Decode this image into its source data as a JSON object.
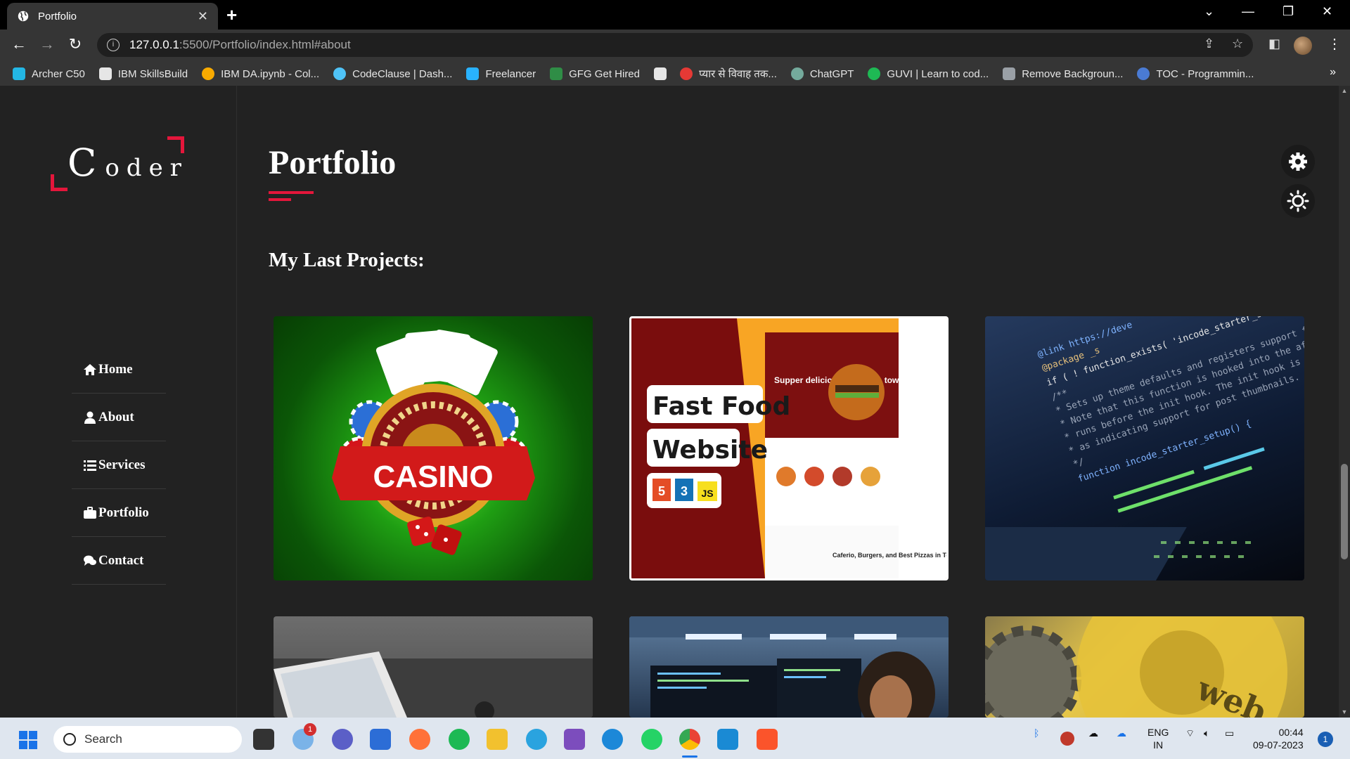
{
  "browser": {
    "tab_title": "Portfolio",
    "url_host": "127.0.0.1",
    "url_path": ":5500/Portfolio/index.html#about"
  },
  "bookmarks": [
    {
      "label": "Archer C50",
      "icon": "tplink-icon",
      "color": "#23b7e5"
    },
    {
      "label": "IBM SkillsBuild",
      "icon": "ibm-icon",
      "color": "#e6e6e6"
    },
    {
      "label": "IBM DA.ipynb - Col...",
      "icon": "colab-icon",
      "color": "#f9ab00"
    },
    {
      "label": "CodeClause | Dash...",
      "icon": "codeclause-icon",
      "color": "#4fc3f7"
    },
    {
      "label": "Freelancer",
      "icon": "freelancer-icon",
      "color": "#29b2fe"
    },
    {
      "label": "GFG Get Hired",
      "icon": "gfg-icon",
      "color": "#2f8d46"
    },
    {
      "label": "",
      "icon": "book-icon",
      "color": "#e6e6e6"
    },
    {
      "label": "प्यार से विवाह तक...",
      "icon": "heart-icon",
      "color": "#e53935"
    },
    {
      "label": "ChatGPT",
      "icon": "chatgpt-icon",
      "color": "#74aa9c"
    },
    {
      "label": "GUVI | Learn to cod...",
      "icon": "guvi-icon",
      "color": "#1eb954"
    },
    {
      "label": "Remove Backgroun...",
      "icon": "removebg-icon",
      "color": "#9aa0a6"
    },
    {
      "label": "TOC - Programmin...",
      "icon": "toc-icon",
      "color": "#4a7bd4"
    }
  ],
  "site": {
    "logo_first": "C",
    "logo_rest": "oder",
    "nav": [
      {
        "label": "Home",
        "icon": "home-icon"
      },
      {
        "label": "About",
        "icon": "user-icon"
      },
      {
        "label": "Services",
        "icon": "list-icon"
      },
      {
        "label": "Portfolio",
        "icon": "briefcase-icon"
      },
      {
        "label": "Contact",
        "icon": "comments-icon"
      }
    ],
    "page_title": "Portfolio",
    "subheading": "My Last Projects:",
    "accent_color": "#e4163b",
    "projects": [
      {
        "name": "casino",
        "text": "CASINO"
      },
      {
        "name": "fast-food-website",
        "lines": [
          "Fast Food",
          "Website"
        ],
        "tech": [
          "5",
          "3",
          "JS"
        ],
        "headline": "Supper delicious Burger in town!",
        "footer_text": "Caferio, Burgers, and Best Pizzas in Town!"
      },
      {
        "name": "code-screen",
        "code_lines": [
          "@link https://deve",
          "@package _s",
          "if ( ! function_exists( 'incode_starter_setup' ) ) :",
          "/**",
          " * Sets up theme defaults and registers support for various WordPr",
          " * Note that this function is hooked into the after_setup_theme hook",
          " * runs before the init hook. The init hook is too late for some",
          " * as indicating support for post thumbnails.",
          " */",
          "function incode_starter_setup() {"
        ]
      },
      {
        "name": "laptop-desk"
      },
      {
        "name": "developer-office"
      },
      {
        "name": "web-gears",
        "text": "web"
      }
    ]
  },
  "taskbar": {
    "search_placeholder": "Search",
    "badge_count": "1",
    "lang_line1": "ENG",
    "lang_line2": "IN",
    "time": "00:44",
    "date": "09-07-2023",
    "notification_count": "1"
  }
}
